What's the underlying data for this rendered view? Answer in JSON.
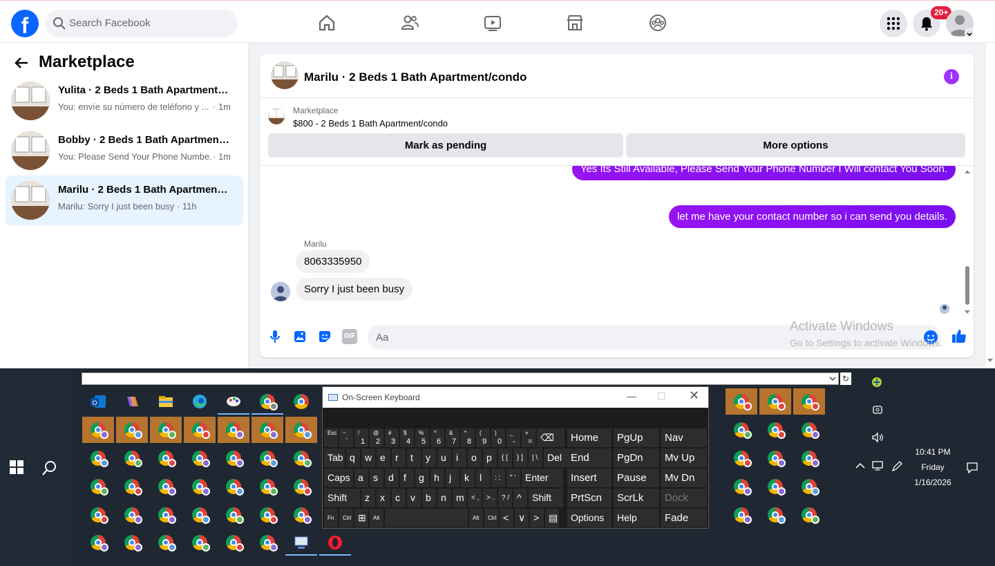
{
  "topbar": {
    "search_placeholder": "Search Facebook",
    "notif_badge": "20+",
    "nav_icons": [
      "home-icon",
      "friends-icon",
      "watch-icon",
      "marketplace-icon",
      "groups-icon"
    ]
  },
  "sidebar": {
    "title": "Marketplace",
    "conversations": [
      {
        "name": "Yulita · 2 Beds 1 Bath Apartment/c...",
        "preview": "You: envíe su número de teléfono y ...",
        "time": "· 1m"
      },
      {
        "name": "Bobby · 2 Beds 1 Bath Apartment/...",
        "preview": "You: Please Send Your Phone Numbe...",
        "time": "· 1m"
      },
      {
        "name": "Marilu · 2 Beds 1 Bath Apartment/...",
        "preview": "Marilu: Sorry I just been busy · 11h",
        "time": ""
      }
    ]
  },
  "chat": {
    "title": "Marilu · 2 Beds 1 Bath Apartment/condo",
    "listing_source": "Marketplace",
    "listing_price": "$800 - 2 Beds 1 Bath Apartment/condo",
    "mark_pending": "Mark as pending",
    "more_options": "More options",
    "msg_out_1": "Yes Its Still Available, Please Send Your Phone Number I Will contact You Soon.",
    "msg_out_2": "let me have your contact number so i can send you details.",
    "sender_name": "Marilu",
    "msg_in_1": "8063335950",
    "msg_in_2": "Sorry I just been busy",
    "composer_placeholder": "Aa",
    "gif_label": "GIF"
  },
  "watermark": {
    "line1": "Activate Windows",
    "line2": "Go to Settings to activate Windows."
  },
  "taskbar": {
    "refresh_glyph": "↻",
    "time": "10:41 PM",
    "day": "Friday",
    "date": "1/16/2026"
  },
  "osk": {
    "title": "On-Screen Keyboard",
    "row1": [
      [
        "Esc",
        ""
      ],
      [
        "~",
        "`"
      ],
      [
        "!",
        "1"
      ],
      [
        "@",
        "2"
      ],
      [
        "#",
        "3"
      ],
      [
        "$",
        "4"
      ],
      [
        "%",
        "5"
      ],
      [
        "^",
        "6"
      ],
      [
        "&",
        "7"
      ],
      [
        "*",
        "8"
      ],
      [
        "(",
        "9"
      ],
      [
        ")",
        "0"
      ],
      [
        "_",
        "-"
      ],
      [
        "+",
        "="
      ]
    ],
    "row2": [
      "Tab",
      "q",
      "w",
      "e",
      "r",
      "t",
      "y",
      "u",
      "i",
      "o",
      "p",
      "{ [",
      "} ]",
      "| \\",
      "Del"
    ],
    "row3": [
      "Caps",
      "a",
      "s",
      "d",
      "f",
      "g",
      "h",
      "j",
      "k",
      "l",
      ": ;",
      "\" '",
      "Enter"
    ],
    "row4": [
      "Shift",
      "z",
      "x",
      "c",
      "v",
      "b",
      "n",
      "m",
      "< ,",
      "> .",
      "? /",
      "^",
      "Shift"
    ],
    "row5": [
      "Fn",
      "Ctrl",
      "⊞",
      "Alt",
      "",
      "Alt",
      "Ctrl",
      "<",
      "∨",
      ">",
      "▤"
    ],
    "nav": [
      [
        "Home",
        "PgUp",
        "Nav"
      ],
      [
        "End",
        "PgDn",
        "Mv Up"
      ],
      [
        "Insert",
        "Pause",
        "Mv Dn"
      ],
      [
        "PrtScn",
        "ScrLk",
        "Dock"
      ],
      [
        "Options",
        "Help",
        "Fade"
      ]
    ]
  }
}
